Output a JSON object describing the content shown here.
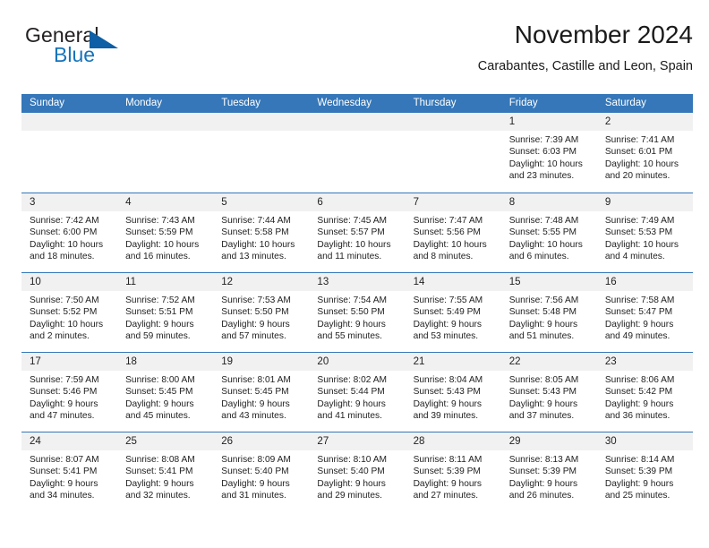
{
  "brand": {
    "name_part1": "General",
    "name_part2": "Blue",
    "triangle_color": "#0e5fa5",
    "blue_color": "#1574bb"
  },
  "header": {
    "title": "November 2024",
    "subtitle": "Carabantes, Castille and Leon, Spain"
  },
  "theme": {
    "header_bar": "#3577b9",
    "day_band": "#f1f1f1",
    "text": "#222222"
  },
  "weekdays": [
    "Sunday",
    "Monday",
    "Tuesday",
    "Wednesday",
    "Thursday",
    "Friday",
    "Saturday"
  ],
  "weeks": [
    [
      {
        "day": "",
        "sunrise": "",
        "sunset": "",
        "daylight": "",
        "daylight2": ""
      },
      {
        "day": "",
        "sunrise": "",
        "sunset": "",
        "daylight": "",
        "daylight2": ""
      },
      {
        "day": "",
        "sunrise": "",
        "sunset": "",
        "daylight": "",
        "daylight2": ""
      },
      {
        "day": "",
        "sunrise": "",
        "sunset": "",
        "daylight": "",
        "daylight2": ""
      },
      {
        "day": "",
        "sunrise": "",
        "sunset": "",
        "daylight": "",
        "daylight2": ""
      },
      {
        "day": "1",
        "sunrise": "Sunrise: 7:39 AM",
        "sunset": "Sunset: 6:03 PM",
        "daylight": "Daylight: 10 hours",
        "daylight2": "and 23 minutes."
      },
      {
        "day": "2",
        "sunrise": "Sunrise: 7:41 AM",
        "sunset": "Sunset: 6:01 PM",
        "daylight": "Daylight: 10 hours",
        "daylight2": "and 20 minutes."
      }
    ],
    [
      {
        "day": "3",
        "sunrise": "Sunrise: 7:42 AM",
        "sunset": "Sunset: 6:00 PM",
        "daylight": "Daylight: 10 hours",
        "daylight2": "and 18 minutes."
      },
      {
        "day": "4",
        "sunrise": "Sunrise: 7:43 AM",
        "sunset": "Sunset: 5:59 PM",
        "daylight": "Daylight: 10 hours",
        "daylight2": "and 16 minutes."
      },
      {
        "day": "5",
        "sunrise": "Sunrise: 7:44 AM",
        "sunset": "Sunset: 5:58 PM",
        "daylight": "Daylight: 10 hours",
        "daylight2": "and 13 minutes."
      },
      {
        "day": "6",
        "sunrise": "Sunrise: 7:45 AM",
        "sunset": "Sunset: 5:57 PM",
        "daylight": "Daylight: 10 hours",
        "daylight2": "and 11 minutes."
      },
      {
        "day": "7",
        "sunrise": "Sunrise: 7:47 AM",
        "sunset": "Sunset: 5:56 PM",
        "daylight": "Daylight: 10 hours",
        "daylight2": "and 8 minutes."
      },
      {
        "day": "8",
        "sunrise": "Sunrise: 7:48 AM",
        "sunset": "Sunset: 5:55 PM",
        "daylight": "Daylight: 10 hours",
        "daylight2": "and 6 minutes."
      },
      {
        "day": "9",
        "sunrise": "Sunrise: 7:49 AM",
        "sunset": "Sunset: 5:53 PM",
        "daylight": "Daylight: 10 hours",
        "daylight2": "and 4 minutes."
      }
    ],
    [
      {
        "day": "10",
        "sunrise": "Sunrise: 7:50 AM",
        "sunset": "Sunset: 5:52 PM",
        "daylight": "Daylight: 10 hours",
        "daylight2": "and 2 minutes."
      },
      {
        "day": "11",
        "sunrise": "Sunrise: 7:52 AM",
        "sunset": "Sunset: 5:51 PM",
        "daylight": "Daylight: 9 hours",
        "daylight2": "and 59 minutes."
      },
      {
        "day": "12",
        "sunrise": "Sunrise: 7:53 AM",
        "sunset": "Sunset: 5:50 PM",
        "daylight": "Daylight: 9 hours",
        "daylight2": "and 57 minutes."
      },
      {
        "day": "13",
        "sunrise": "Sunrise: 7:54 AM",
        "sunset": "Sunset: 5:50 PM",
        "daylight": "Daylight: 9 hours",
        "daylight2": "and 55 minutes."
      },
      {
        "day": "14",
        "sunrise": "Sunrise: 7:55 AM",
        "sunset": "Sunset: 5:49 PM",
        "daylight": "Daylight: 9 hours",
        "daylight2": "and 53 minutes."
      },
      {
        "day": "15",
        "sunrise": "Sunrise: 7:56 AM",
        "sunset": "Sunset: 5:48 PM",
        "daylight": "Daylight: 9 hours",
        "daylight2": "and 51 minutes."
      },
      {
        "day": "16",
        "sunrise": "Sunrise: 7:58 AM",
        "sunset": "Sunset: 5:47 PM",
        "daylight": "Daylight: 9 hours",
        "daylight2": "and 49 minutes."
      }
    ],
    [
      {
        "day": "17",
        "sunrise": "Sunrise: 7:59 AM",
        "sunset": "Sunset: 5:46 PM",
        "daylight": "Daylight: 9 hours",
        "daylight2": "and 47 minutes."
      },
      {
        "day": "18",
        "sunrise": "Sunrise: 8:00 AM",
        "sunset": "Sunset: 5:45 PM",
        "daylight": "Daylight: 9 hours",
        "daylight2": "and 45 minutes."
      },
      {
        "day": "19",
        "sunrise": "Sunrise: 8:01 AM",
        "sunset": "Sunset: 5:45 PM",
        "daylight": "Daylight: 9 hours",
        "daylight2": "and 43 minutes."
      },
      {
        "day": "20",
        "sunrise": "Sunrise: 8:02 AM",
        "sunset": "Sunset: 5:44 PM",
        "daylight": "Daylight: 9 hours",
        "daylight2": "and 41 minutes."
      },
      {
        "day": "21",
        "sunrise": "Sunrise: 8:04 AM",
        "sunset": "Sunset: 5:43 PM",
        "daylight": "Daylight: 9 hours",
        "daylight2": "and 39 minutes."
      },
      {
        "day": "22",
        "sunrise": "Sunrise: 8:05 AM",
        "sunset": "Sunset: 5:43 PM",
        "daylight": "Daylight: 9 hours",
        "daylight2": "and 37 minutes."
      },
      {
        "day": "23",
        "sunrise": "Sunrise: 8:06 AM",
        "sunset": "Sunset: 5:42 PM",
        "daylight": "Daylight: 9 hours",
        "daylight2": "and 36 minutes."
      }
    ],
    [
      {
        "day": "24",
        "sunrise": "Sunrise: 8:07 AM",
        "sunset": "Sunset: 5:41 PM",
        "daylight": "Daylight: 9 hours",
        "daylight2": "and 34 minutes."
      },
      {
        "day": "25",
        "sunrise": "Sunrise: 8:08 AM",
        "sunset": "Sunset: 5:41 PM",
        "daylight": "Daylight: 9 hours",
        "daylight2": "and 32 minutes."
      },
      {
        "day": "26",
        "sunrise": "Sunrise: 8:09 AM",
        "sunset": "Sunset: 5:40 PM",
        "daylight": "Daylight: 9 hours",
        "daylight2": "and 31 minutes."
      },
      {
        "day": "27",
        "sunrise": "Sunrise: 8:10 AM",
        "sunset": "Sunset: 5:40 PM",
        "daylight": "Daylight: 9 hours",
        "daylight2": "and 29 minutes."
      },
      {
        "day": "28",
        "sunrise": "Sunrise: 8:11 AM",
        "sunset": "Sunset: 5:39 PM",
        "daylight": "Daylight: 9 hours",
        "daylight2": "and 27 minutes."
      },
      {
        "day": "29",
        "sunrise": "Sunrise: 8:13 AM",
        "sunset": "Sunset: 5:39 PM",
        "daylight": "Daylight: 9 hours",
        "daylight2": "and 26 minutes."
      },
      {
        "day": "30",
        "sunrise": "Sunrise: 8:14 AM",
        "sunset": "Sunset: 5:39 PM",
        "daylight": "Daylight: 9 hours",
        "daylight2": "and 25 minutes."
      }
    ]
  ]
}
